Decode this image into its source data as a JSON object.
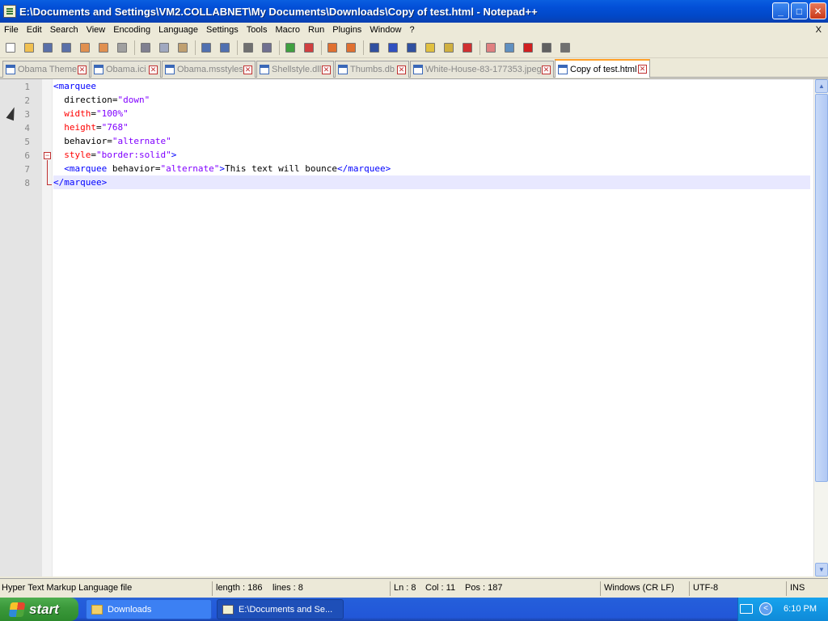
{
  "window": {
    "title": "E:\\Documents and Settings\\VM2.COLLABNET\\My Documents\\Downloads\\Copy of test.html - Notepad++",
    "controls": {
      "minimize": "_",
      "maximize": "□",
      "close": "✕"
    }
  },
  "menu": {
    "items": [
      "File",
      "Edit",
      "Search",
      "View",
      "Encoding",
      "Language",
      "Settings",
      "Tools",
      "Macro",
      "Run",
      "Plugins",
      "Window",
      "?"
    ],
    "close_glyph": "X"
  },
  "toolbar": {
    "icons": [
      {
        "name": "new-file-icon",
        "color": "#ffffff"
      },
      {
        "name": "open-file-icon",
        "color": "#f0c050"
      },
      {
        "name": "save-icon",
        "color": "#5a70a8"
      },
      {
        "name": "save-all-icon",
        "color": "#5a70a8"
      },
      {
        "name": "close-icon",
        "color": "#e09050"
      },
      {
        "name": "close-all-icon",
        "color": "#e09050"
      },
      {
        "name": "print-icon",
        "color": "#a0a0a0"
      },
      {
        "name": "cut-icon",
        "color": "#808090"
      },
      {
        "name": "copy-icon",
        "color": "#a0a8c0"
      },
      {
        "name": "paste-icon",
        "color": "#c0a070"
      },
      {
        "name": "undo-icon",
        "color": "#5070b0"
      },
      {
        "name": "redo-icon",
        "color": "#5070b0"
      },
      {
        "name": "find-icon",
        "color": "#707070"
      },
      {
        "name": "replace-icon",
        "color": "#707090"
      },
      {
        "name": "zoom-in-icon",
        "color": "#40a040"
      },
      {
        "name": "zoom-out-icon",
        "color": "#d04040"
      },
      {
        "name": "sync-vertical-icon",
        "color": "#e07030"
      },
      {
        "name": "sync-horizontal-icon",
        "color": "#e07030"
      },
      {
        "name": "word-wrap-icon",
        "color": "#3050a0"
      },
      {
        "name": "show-all-chars-icon",
        "color": "#3050c0"
      },
      {
        "name": "indent-guide-icon",
        "color": "#3050a0"
      },
      {
        "name": "user-lang-icon",
        "color": "#e0c040"
      },
      {
        "name": "function-list-icon",
        "color": "#d0b040"
      },
      {
        "name": "doc-map-icon",
        "color": "#d03030"
      },
      {
        "name": "folder-workspace-icon",
        "color": "#e08080"
      },
      {
        "name": "monitor-icon",
        "color": "#6090c0"
      },
      {
        "name": "record-macro-icon",
        "color": "#d02020"
      },
      {
        "name": "stop-macro-icon",
        "color": "#606060"
      },
      {
        "name": "play-macro-icon",
        "color": "#707070"
      },
      {
        "name": "run-macro-multiple-icon",
        "color": "#3060c0"
      },
      {
        "name": "save-macro-icon",
        "color": "#707070"
      }
    ]
  },
  "tabs": [
    {
      "label": "Obama Theme",
      "active": false
    },
    {
      "label": "Obama.ici",
      "active": false
    },
    {
      "label": "Obama.msstyles",
      "active": false
    },
    {
      "label": "Shellstyle.dll",
      "active": false
    },
    {
      "label": "Thumbs.db",
      "active": false
    },
    {
      "label": "White-House-83-177353.jpeg",
      "active": false
    },
    {
      "label": "Copy of test.html",
      "active": true
    }
  ],
  "editor": {
    "line_numbers": [
      "1",
      "2",
      "3",
      "4",
      "5",
      "6",
      "7",
      "8"
    ],
    "lines": [
      [
        {
          "t": "<marquee",
          "c": "tag"
        }
      ],
      [
        {
          "t": "  direction",
          "c": "txt"
        },
        {
          "t": "=",
          "c": "txt"
        },
        {
          "t": "\"down\"",
          "c": "val"
        }
      ],
      [
        {
          "t": "  width",
          "c": "attr"
        },
        {
          "t": "=",
          "c": "txt"
        },
        {
          "t": "\"100%\"",
          "c": "val"
        }
      ],
      [
        {
          "t": "  height",
          "c": "attr"
        },
        {
          "t": "=",
          "c": "txt"
        },
        {
          "t": "\"768\"",
          "c": "val"
        }
      ],
      [
        {
          "t": "  behavior",
          "c": "txt"
        },
        {
          "t": "=",
          "c": "txt"
        },
        {
          "t": "\"alternate\"",
          "c": "val"
        }
      ],
      [
        {
          "t": "  style",
          "c": "attr"
        },
        {
          "t": "=",
          "c": "txt"
        },
        {
          "t": "\"border:solid\"",
          "c": "val"
        },
        {
          "t": ">",
          "c": "tag"
        }
      ],
      [
        {
          "t": "  <marquee",
          "c": "tag"
        },
        {
          "t": " behavior",
          "c": "txt"
        },
        {
          "t": "=",
          "c": "txt"
        },
        {
          "t": "\"alternate\"",
          "c": "val"
        },
        {
          "t": ">",
          "c": "tag"
        },
        {
          "t": "This text will bounce",
          "c": "txt"
        },
        {
          "t": "</marquee>",
          "c": "tag"
        }
      ],
      [
        {
          "t": "</marquee>",
          "c": "tag"
        }
      ]
    ],
    "current_line": 8,
    "fold_glyph": "−"
  },
  "status": {
    "file_type": "Hyper Text Markup Language file",
    "length": "length : 186",
    "lines": "lines : 8",
    "ln": "Ln : 8",
    "col": "Col : 11",
    "pos": "Pos : 187",
    "eol": "Windows (CR LF)",
    "encoding": "UTF-8",
    "mode": "INS"
  },
  "taskbar": {
    "start_label": "start",
    "tasks": [
      {
        "label": "Downloads",
        "active": false
      },
      {
        "label": "E:\\Documents and Se...",
        "active": true
      }
    ],
    "tray_arrow": "<",
    "clock": "6:10 PM"
  },
  "colors": {
    "tag": "#0000ff",
    "attribute": "#ff0000",
    "value": "#8000ff",
    "text": "#000000",
    "current_line": "#e8e8ff",
    "active_tab_accent": "#ffa028"
  }
}
